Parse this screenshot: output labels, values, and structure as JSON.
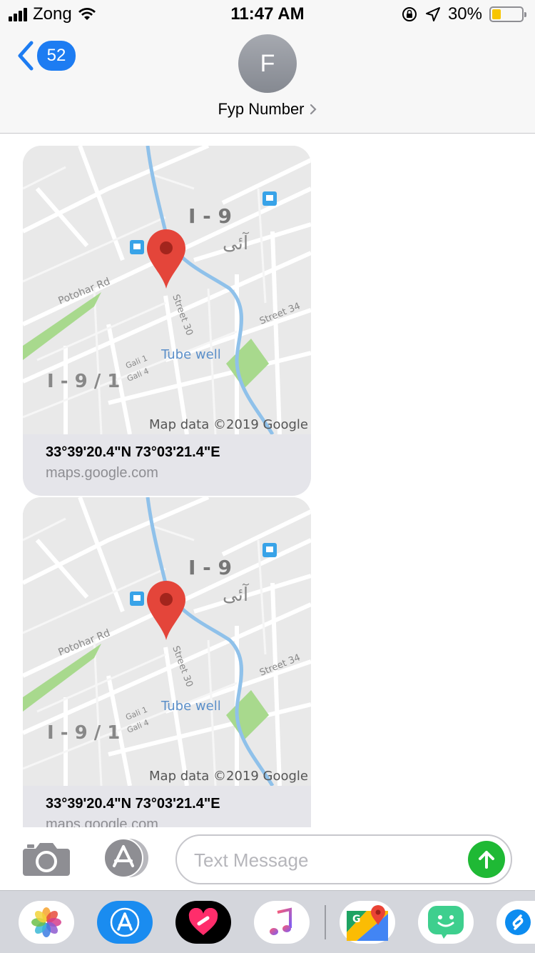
{
  "status_bar": {
    "carrier": "Zong",
    "time": "11:47 AM",
    "battery": "30%",
    "icons": [
      "signal-bars-icon",
      "wifi-icon",
      "rotation-lock-icon",
      "location-arrow-icon",
      "battery-icon"
    ]
  },
  "header": {
    "back_count": "52",
    "avatar_initial": "F",
    "contact_name": "Fyp Number"
  },
  "messages": [
    {
      "map_labels": {
        "sector_top": "I - 9",
        "urdu": "آئی",
        "road": "Potohar Rd",
        "street30": "Street 30",
        "street34": "Street 34",
        "tubewell": "Tube well",
        "gali1": "Gali 1",
        "gali4": "Gali 4",
        "sector_bottom": "I - 9 / 1",
        "attribution": "Map data ©2019 Google"
      },
      "coords": "33°39'20.4\"N 73°03'21.4\"E",
      "domain": "maps.google.com"
    },
    {
      "map_labels": {
        "sector_top": "I - 9",
        "urdu": "آئی",
        "road": "Potohar Rd",
        "street30": "Street 30",
        "street34": "Street 34",
        "tubewell": "Tube well",
        "gali1": "Gali 1",
        "gali4": "Gali 4",
        "sector_bottom": "I - 9 / 1",
        "attribution": "Map data ©2019 Google"
      },
      "coords": "33°39'20.4\"N 73°03'21.4\"E",
      "domain": "maps.google.com"
    }
  ],
  "compose": {
    "placeholder": "Text Message"
  },
  "app_drawer": [
    {
      "name": "photos-app-icon"
    },
    {
      "name": "app-store-app-icon"
    },
    {
      "name": "digital-touch-app-icon"
    },
    {
      "name": "music-app-icon"
    },
    {
      "name": "google-maps-app-icon"
    },
    {
      "name": "bitmoji-app-icon"
    },
    {
      "name": "shazam-app-icon"
    }
  ],
  "colors": {
    "accent_blue": "#1d7cf2",
    "send_green": "#1fb935",
    "bubble_gray": "#e5e5ea",
    "map_pin_red": "#e4453a"
  }
}
